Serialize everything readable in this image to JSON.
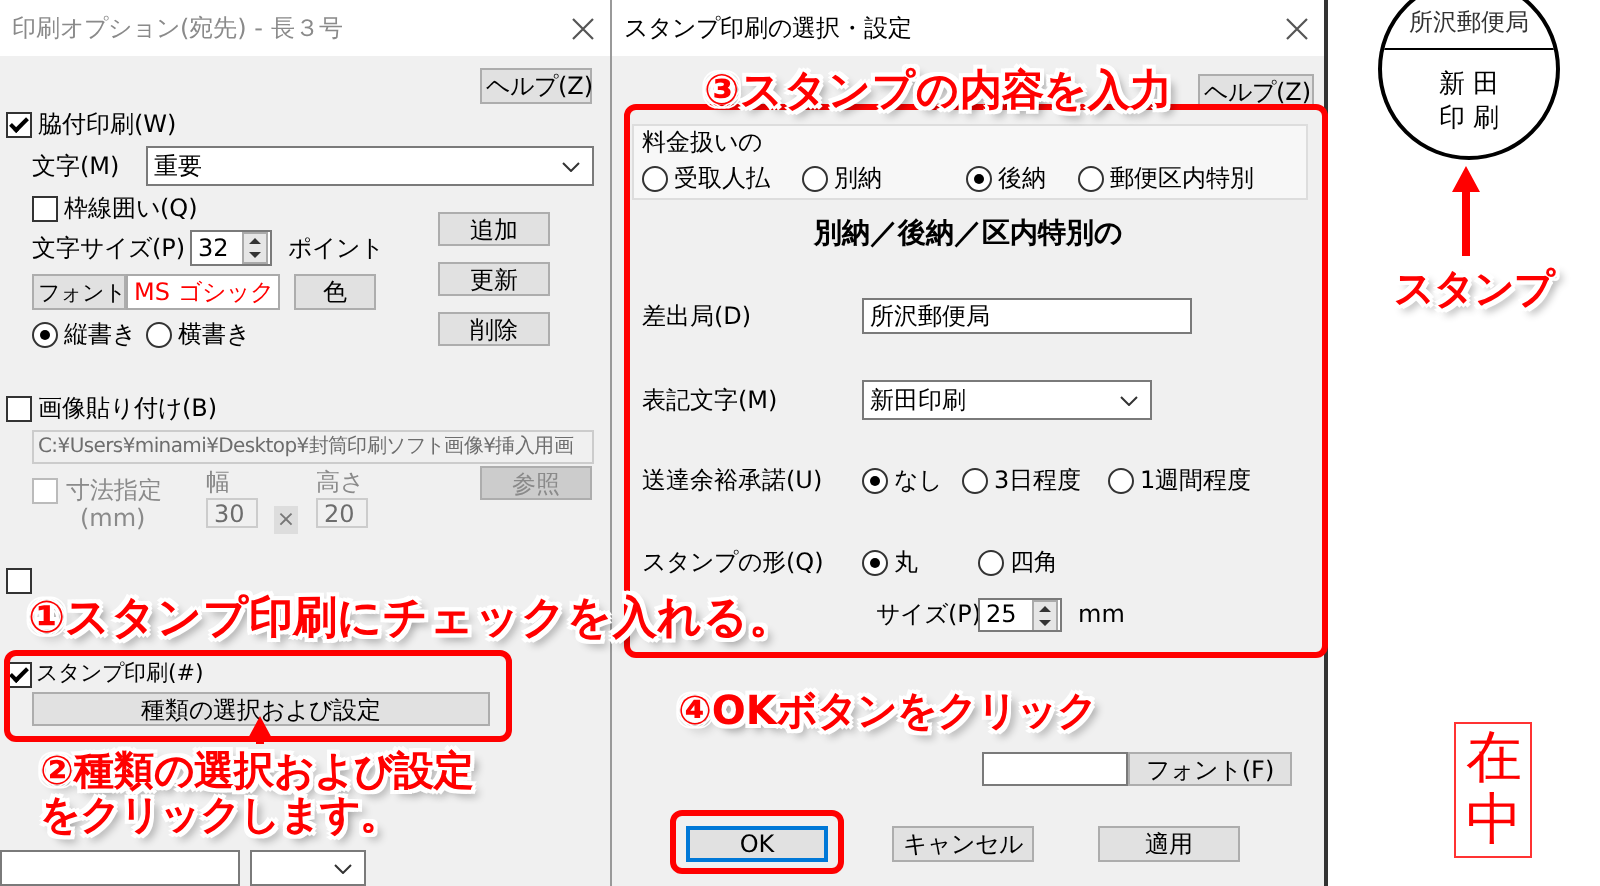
{
  "options_window": {
    "title": "印刷オプション(宛先) - 長３号",
    "help_button": "ヘルプ(Z)",
    "wakizuke": {
      "label": "脇付印刷(W)",
      "checked": true,
      "text_label": "文字(M)",
      "text_value": "重要",
      "frame": {
        "label": "枠線囲い(Q)",
        "checked": false
      },
      "size_label": "文字サイズ(P)",
      "size_value": "32",
      "size_unit": "ポイント",
      "font_button": "フォント",
      "font_name": "MS ゴシック",
      "color_button": "色",
      "orientation": [
        {
          "label": "縦書き",
          "selected": true
        },
        {
          "label": "横書き",
          "selected": false
        }
      ],
      "buttons": [
        "追加",
        "更新",
        "削除"
      ]
    },
    "image": {
      "label": "画像貼り付け(B)",
      "checked": false,
      "disabled": true,
      "path": "C:¥Users¥minami¥Desktop¥封筒印刷ソフト画像¥挿入用画",
      "size_spec": {
        "label": "寸法指定",
        "unit": "(mm)",
        "checked": false
      },
      "width_label": "幅",
      "width_value": "30",
      "times": "×",
      "height_label": "高さ",
      "height_value": "20",
      "browse_button": "参照"
    },
    "barcode": {
      "checked": false
    },
    "stamp": {
      "label": "スタンプ印刷(#)",
      "checked": true,
      "button": "種類の選択および設定"
    }
  },
  "stamp_dialog": {
    "title": "スタンプ印刷の選択・設定",
    "help_button": "ヘルプ(Z)",
    "fee_label": "料金扱いの",
    "fee_options": [
      {
        "label": "受取人払",
        "selected": false
      },
      {
        "label": "別納",
        "selected": false
      },
      {
        "label": "後納",
        "selected": true
      },
      {
        "label": "郵便区内特別",
        "selected": false
      }
    ],
    "heading": "別納／後納／区内特別の",
    "office_label": "差出局(D)",
    "office_value": "所沢郵便局",
    "notation_label": "表記文字(M)",
    "notation_value": "新田印刷",
    "delivery_label": "送達余裕承諾(U)",
    "delivery_options": [
      {
        "label": "なし",
        "selected": true
      },
      {
        "label": "3日程度",
        "selected": false
      },
      {
        "label": "1週間程度",
        "selected": false
      }
    ],
    "shape_label": "スタンプの形(Q)",
    "shape_options": [
      {
        "label": "丸",
        "selected": true
      },
      {
        "label": "四角",
        "selected": false
      }
    ],
    "size_label": "サイズ(P)",
    "size_value": "25",
    "size_unit": "mm",
    "font_button": "フォント(F)",
    "buttons": [
      "OK",
      "キャンセル",
      "適用"
    ]
  },
  "preview": {
    "stamp_office": "所沢郵便局",
    "stamp_lines": [
      "新 田",
      "印 刷"
    ],
    "enclosure": "在中"
  },
  "annotations": [
    {
      "kind": "callout",
      "lines": [
        "①スタンプ印刷にチェックを入れる。"
      ]
    },
    {
      "kind": "callout",
      "lines": [
        "②種類の選択および設定",
        "をクリックします。"
      ]
    },
    {
      "kind": "callout",
      "lines": [
        "③スタンプの内容を入力"
      ]
    },
    {
      "kind": "callout",
      "lines": [
        "④OKボタンをクリック"
      ]
    },
    {
      "kind": "callout",
      "lines": [
        "スタンプ"
      ]
    }
  ]
}
